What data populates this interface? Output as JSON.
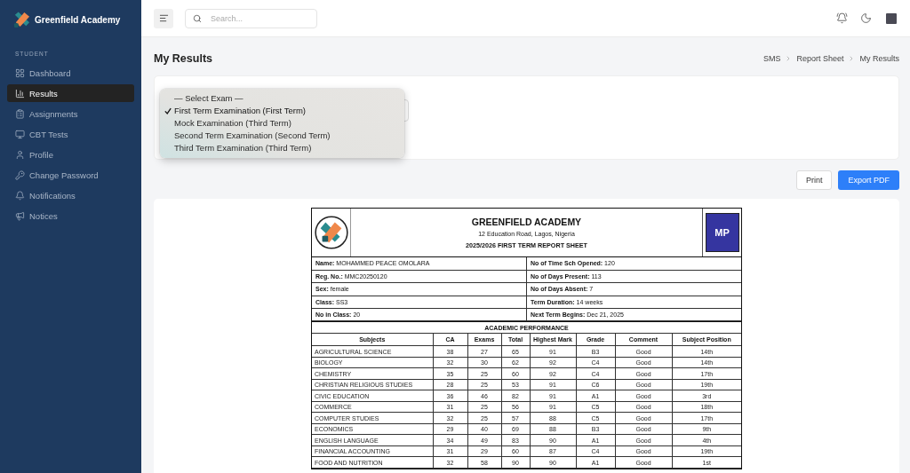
{
  "sidebar": {
    "brand": "Greenfield Academy",
    "section": "STUDENT",
    "items": [
      {
        "label": "Dashboard",
        "selected": false
      },
      {
        "label": "Results",
        "selected": true
      },
      {
        "label": "Assignments",
        "selected": false
      },
      {
        "label": "CBT Tests",
        "selected": false
      },
      {
        "label": "Profile",
        "selected": false
      },
      {
        "label": "Change Password",
        "selected": false
      },
      {
        "label": "Notifications",
        "selected": false
      },
      {
        "label": "Notices",
        "selected": false
      }
    ]
  },
  "topbar": {
    "search": {
      "placeholder": "Search..."
    }
  },
  "page": {
    "title": "My Results",
    "breadcrumb": [
      "SMS",
      "Report Sheet",
      "My Results"
    ]
  },
  "exam_select": {
    "options": [
      {
        "label": "— Select Exam —",
        "selected": false
      },
      {
        "label": "First Term Examination (First Term)",
        "selected": true
      },
      {
        "label": "Mock Examination (Third Term)",
        "selected": false
      },
      {
        "label": "Second Term Examination (Second Term)",
        "selected": false
      },
      {
        "label": "Third Term Examination (Third Term)",
        "selected": false
      }
    ]
  },
  "actions": [
    {
      "label": "Print",
      "kind": "outline"
    },
    {
      "label": "Export PDF",
      "kind": "primary"
    }
  ],
  "report": {
    "school": "GREENFIELD ACADEMY",
    "address": "12 Education Road, Lagos, Nigeria",
    "title": "2025/2026 FIRST TERM REPORT SHEET",
    "initials": "MP",
    "info": [
      [
        "**Name:** MOHAMMED PEACE OMOLARA",
        "**No of Time Sch Opened:** 120"
      ],
      [
        "**Reg. No.:** MMC20250120",
        "**No of Days Present:** 113"
      ],
      [
        "**Sex:** female",
        "**No of Days Absent:** 7"
      ],
      [
        "**Class:** SS3",
        "**Term Duration:** 14 weeks"
      ],
      [
        "**No in Class:** 20",
        "**Next Term Begins:** Dec 21, 2025"
      ]
    ],
    "section_title": "ACADEMIC PERFORMANCE",
    "columns": [
      "Subjects",
      "CA",
      "Exams",
      "Total",
      "Highest Mark",
      "Grade",
      "Comment",
      "Subject Position"
    ],
    "rows": [
      [
        "AGRICULTURAL SCIENCE",
        "38",
        "27",
        "65",
        "91",
        "B3",
        "Good",
        "14th"
      ],
      [
        "BIOLOGY",
        "32",
        "30",
        "62",
        "92",
        "C4",
        "Good",
        "14th"
      ],
      [
        "CHEMISTRY",
        "35",
        "25",
        "60",
        "92",
        "C4",
        "Good",
        "17th"
      ],
      [
        "CHRISTIAN RELIGIOUS STUDIES",
        "28",
        "25",
        "53",
        "91",
        "C6",
        "Good",
        "19th"
      ],
      [
        "CIVIC EDUCATION",
        "36",
        "46",
        "82",
        "91",
        "A1",
        "Good",
        "3rd"
      ],
      [
        "COMMERCE",
        "31",
        "25",
        "56",
        "91",
        "C5",
        "Good",
        "18th"
      ],
      [
        "COMPUTER STUDIES",
        "32",
        "25",
        "57",
        "88",
        "C5",
        "Good",
        "17th"
      ],
      [
        "ECONOMICS",
        "29",
        "40",
        "69",
        "88",
        "B3",
        "Good",
        "9th"
      ],
      [
        "ENGLISH LANGUAGE",
        "34",
        "49",
        "83",
        "90",
        "A1",
        "Good",
        "4th"
      ],
      [
        "FINANCIAL ACCOUNTING",
        "31",
        "29",
        "60",
        "87",
        "C4",
        "Good",
        "19th"
      ],
      [
        "FOOD AND NUTRITION",
        "32",
        "58",
        "90",
        "90",
        "A1",
        "Good",
        "1st"
      ]
    ]
  }
}
